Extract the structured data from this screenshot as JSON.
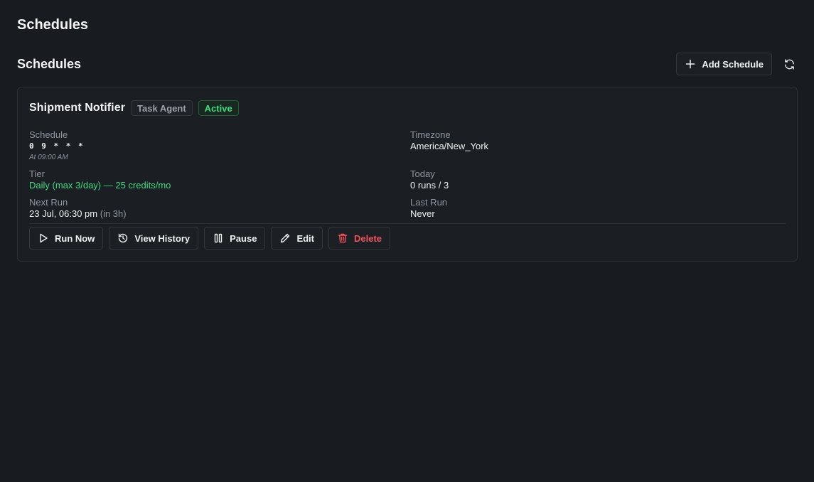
{
  "page": {
    "title": "Schedules"
  },
  "section": {
    "title": "Schedules",
    "add_label": "Add Schedule",
    "refresh_icon": "refresh-icon",
    "add_icon": "plus-icon"
  },
  "schedule": {
    "name": "Shipment Notifier",
    "type_badge": "Task Agent",
    "status_badge": "Active",
    "fields": {
      "schedule_label": "Schedule",
      "cron": "0 9 * * *",
      "cron_hint": "At 09:00 AM",
      "timezone_label": "Timezone",
      "timezone": "America/New_York",
      "tier_label": "Tier",
      "tier": "Daily (max 3/day) — 25 credits/mo",
      "today_label": "Today",
      "today": "0 runs / 3",
      "next_run_label": "Next Run",
      "next_run": "23 Jul, 06:30 pm",
      "next_run_relative": "(in 3h)",
      "last_run_label": "Last Run",
      "last_run": "Never"
    },
    "actions": {
      "run_now": "Run Now",
      "view_history": "View History",
      "pause": "Pause",
      "edit": "Edit",
      "delete": "Delete"
    }
  },
  "colors": {
    "background": "#181b1f",
    "card": "#1b1e22",
    "accent_green": "#3ddc84",
    "danger_red": "#f0525c"
  }
}
